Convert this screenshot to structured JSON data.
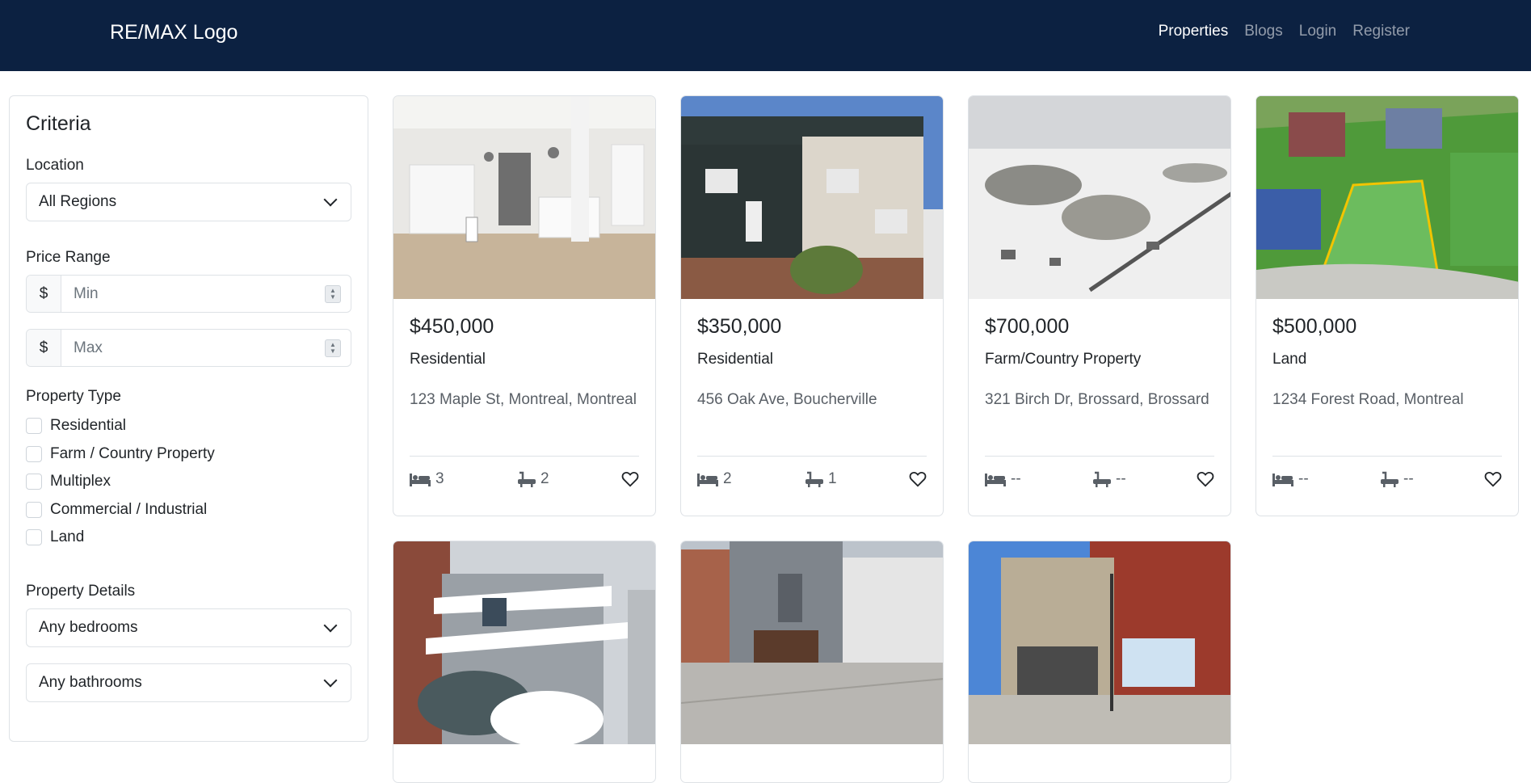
{
  "navbar": {
    "brand": "RE/MAX Logo",
    "links": [
      "Properties",
      "Blogs",
      "Login",
      "Register"
    ]
  },
  "criteria": {
    "title": "Criteria",
    "location_label": "Location",
    "location_value": "All Regions",
    "price_label": "Price Range",
    "currency": "$",
    "min_placeholder": "Min",
    "max_placeholder": "Max",
    "type_label": "Property Type",
    "types": [
      "Residential",
      "Farm / Country Property",
      "Multiplex",
      "Commercial / Industrial",
      "Land"
    ],
    "details_label": "Property Details",
    "bedrooms_value": "Any bedrooms",
    "bathrooms_value": "Any bathrooms"
  },
  "listings": [
    {
      "price": "$450,000",
      "type": "Residential",
      "address": "123 Maple St, Montreal, Montreal",
      "beds": "3",
      "baths": "2"
    },
    {
      "price": "$350,000",
      "type": "Residential",
      "address": "456 Oak Ave, Boucherville",
      "beds": "2",
      "baths": "1"
    },
    {
      "price": "$700,000",
      "type": "Farm/Country Property",
      "address": "321 Birch Dr, Brossard, Brossard",
      "beds": "--",
      "baths": "--"
    },
    {
      "price": "$500,000",
      "type": "Land",
      "address": "1234 Forest Road, Montreal",
      "beds": "--",
      "baths": "--"
    }
  ],
  "colors": {
    "navbar_bg": "#0c2141",
    "border": "#dee2e6",
    "muted_text": "#595f66"
  }
}
